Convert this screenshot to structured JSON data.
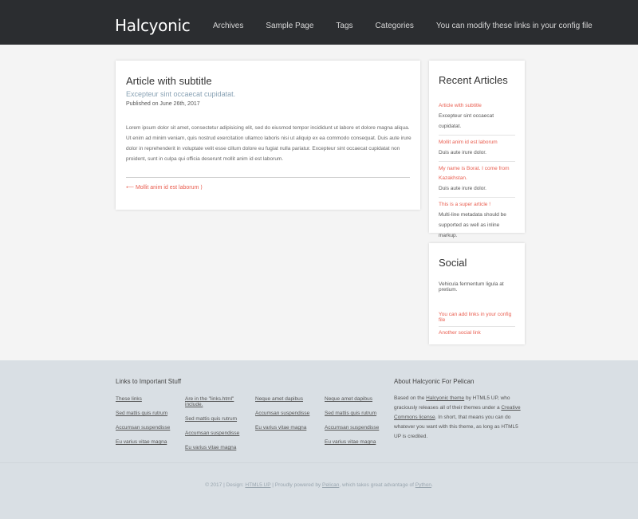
{
  "header": {
    "logo": "Halcyonic",
    "nav": [
      "Archives",
      "Sample Page",
      "Tags",
      "Categories",
      "You can modify these links in your config file"
    ]
  },
  "article": {
    "title": "Article with subtitle",
    "subtitle": "Excepteur sint occaecat cupidatat.",
    "published": "Published on June 26th, 2017",
    "body": "Lorem ipsum dolor sit amet, consectetur adipisicing elit, sed do eiusmod tempor incididunt ut labore et dolore magna aliqua. Ut enim ad minim veniam, quis nostrud exercitation ullamco laboris nisi ut aliquip ex ea commodo consequat. Duis aute irure dolor in reprehenderit in voluptate velit esse cillum dolore eu fugiat nulla pariatur. Excepteur sint occaecat cupidatat non proident, sunt in culpa qui officia deserunt mollit anim id est laborum.",
    "prev_link": "⟵ Mollit anim id est laborum ⟩"
  },
  "recent": {
    "title": "Recent Articles",
    "items": [
      {
        "title": "Article with subtitle",
        "desc": "Excepteur sint occaecat cupidatat."
      },
      {
        "title": "Mollit anim id est laborum",
        "desc": "Duis aute irure dolor."
      },
      {
        "title": "My name is Borat. I come from Kazakhstan.",
        "desc": "Duis aute irure dolor."
      },
      {
        "title": "This is a super article !",
        "desc": "Multi-line metadata should be supported as well as inline markup."
      }
    ]
  },
  "social": {
    "title": "Social",
    "intro": "Vehicula fermentum ligula at pretium.",
    "links": [
      "You can add links in your config file",
      "Another social link"
    ]
  },
  "footer": {
    "links_title": "Links to Important Stuff",
    "columns": [
      [
        "These links",
        "Sed mattis quis rutrum",
        "Accumsan suspendisse",
        "Eu varius vitae magna"
      ],
      [
        "Are in the \"links.html\" include.",
        "Sed mattis quis rutrum",
        "Accumsan suspendisse",
        "Eu varius vitae magna"
      ],
      [
        "Neque amet dapibus",
        "Accumsan suspendisse",
        "Eu varius vitae magna"
      ],
      [
        "Neque amet dapibus",
        "Sed mattis quis rutrum",
        "Accumsan suspendisse",
        "Eu varius vitae magna"
      ]
    ],
    "about_title": "About Halcyonic For Pelican",
    "about": {
      "p1": "Based on the ",
      "link1": "Halcyonic theme",
      "p2": " by HTML5 UP, who graciously releases all of their themes under a ",
      "link2": "Creative Commons license",
      "p3": ". In short, that means you can do whatever you want with this theme, as long as HTML5 UP is credited."
    },
    "copyright": {
      "p1": "© 2017 | Design: ",
      "link1": "HTML5 UP",
      "p2": " | Proudly powered by ",
      "link2": "Pelican",
      "p3": ", which takes great advantage of ",
      "link3": "Python",
      "p4": "."
    }
  }
}
